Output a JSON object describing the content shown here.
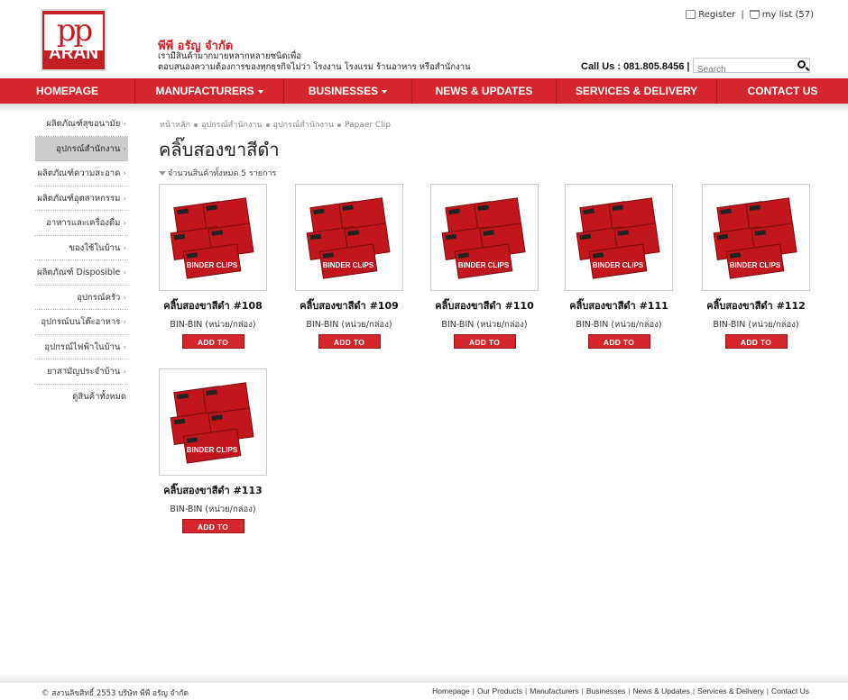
{
  "header": {
    "logo_top": "pp",
    "logo_bottom": "ARAN",
    "company_name": "พีพี อรัญ จำกัด",
    "tagline_1": "เรามีสินค้ามากมายหลากหลายชนิดเพื่อ",
    "tagline_2": "ตอบสนองความต้องการของทุกธุรกิจไม่ว่า โรงงาน โรงแรม ร้านอาหาร หรือสำนักงาน",
    "register_label": "Register",
    "mylist_label": "my list (57)",
    "callus": "Call Us : 081.805.8456",
    "search_placeholder": "Search"
  },
  "nav": [
    {
      "label": "HOMEPAGE"
    },
    {
      "label": "MANUFACTURERS"
    },
    {
      "label": "BUSINESSES"
    },
    {
      "label": "NEWS & UPDATES"
    },
    {
      "label": "SERVICES & DELIVERY"
    },
    {
      "label": "CONTACT US"
    }
  ],
  "sidebar": [
    {
      "label": "ผลิตภัณฑ์สุขอนามัย"
    },
    {
      "label": "อุปกรณ์สำนักงาน"
    },
    {
      "label": "ผลิตภัณฑ์ความสะอาด"
    },
    {
      "label": "ผลิตภัณฑ์อุตสาหกรรม"
    },
    {
      "label": "อาหารและเครื่องดื่ม"
    },
    {
      "label": "ของใช้ในบ้าน"
    },
    {
      "label": "ผลิตภัณฑ์ Disposible"
    },
    {
      "label": "อุปกรณ์ครัว"
    },
    {
      "label": "อุปกรณ์บนโต๊ะอาหาร"
    },
    {
      "label": "อุปกรณ์ไฟฟ้าในบ้าน"
    },
    {
      "label": "ยาสามัญประจำบ้าน"
    },
    {
      "label": "ดูสินค้าทั้งหมด"
    }
  ],
  "breadcrumb": [
    "หน้าหลัก",
    "อุปกรณ์สำนักงาน",
    "อุปกรณ์สำนักงาน",
    "Papaer Clip"
  ],
  "page_title": "คลิ๊บสองขาสีดำ",
  "count_text": "จำนวนสินค้าทั้งหมด 5 รายการ",
  "products": [
    {
      "name": "คลิ๊บสองขาสีดำ #108",
      "unit": "BIN-BIN (หน่วย/กล่อง)",
      "quote": "ADD TO QUOTE"
    },
    {
      "name": "คลิ๊บสองขาสีดำ #109",
      "unit": "BIN-BIN (หน่วย/กล่อง)",
      "quote": "ADD TO QUOTE"
    },
    {
      "name": "คลิ๊บสองขาสีดำ #110",
      "unit": "BIN-BIN (หน่วย/กล่อง)",
      "quote": "ADD TO QUOTE"
    },
    {
      "name": "คลิ๊บสองขาสีดำ #111",
      "unit": "BIN-BIN (หน่วย/กล่อง)",
      "quote": "ADD TO QUOTE"
    },
    {
      "name": "คลิ๊บสองขาสีดำ #112",
      "unit": "BIN-BIN (หน่วย/กล่อง)",
      "quote": "ADD TO QUOTE"
    },
    {
      "name": "คลิ๊บสองขาสีดำ #113",
      "unit": "BIN-BIN (หน่วย/กล่อง)",
      "quote": "ADD TO QUOTE"
    }
  ],
  "product_image_text": "BINDER CLIPS",
  "footer": {
    "copyright": "© สงวนลิขสิทธิ์ 2553 บริษัท พีพี อรัญ จำกัด",
    "links": [
      "Homepage",
      "Our Products",
      "Manufacturers",
      "Businesses",
      "News & Updates",
      "Services & Delivery",
      "Contact Us"
    ]
  },
  "colors": {
    "brand_red": "#d4262c",
    "nav_divider": "#a8181d"
  }
}
